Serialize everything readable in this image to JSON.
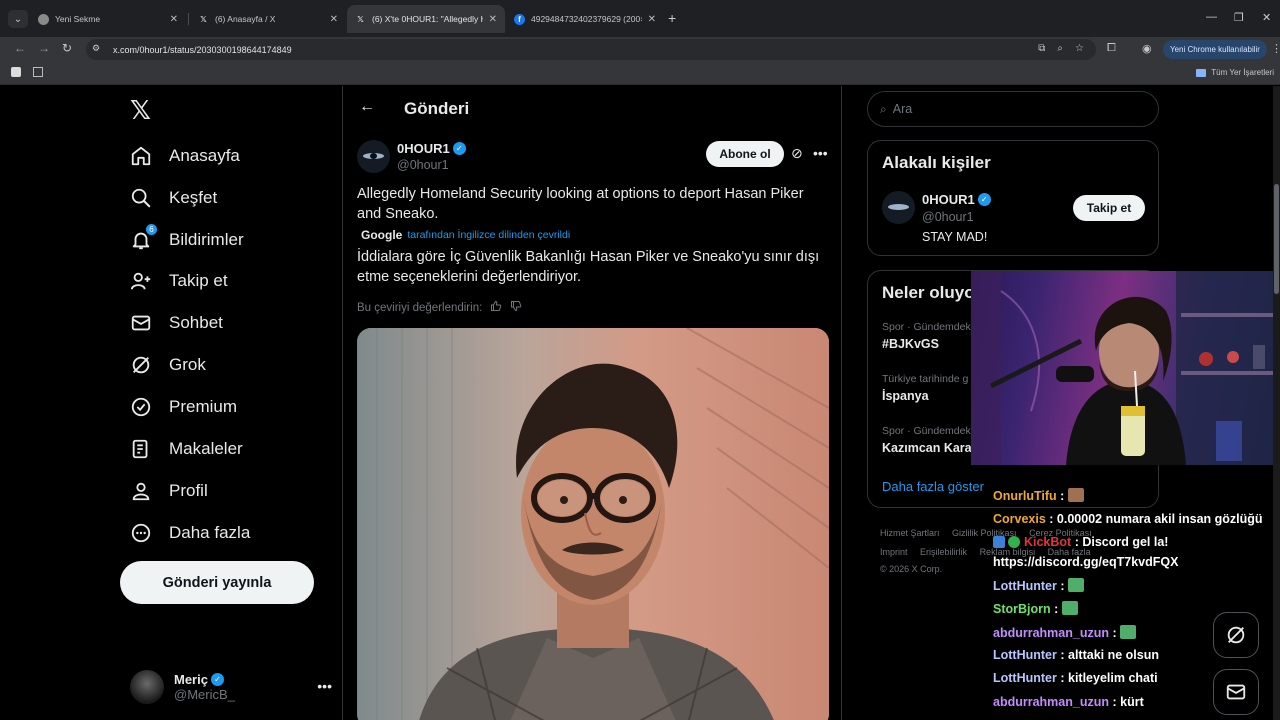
{
  "browser": {
    "tabs": [
      {
        "title": "Yeni Sekme",
        "favicon": "chrome-icon"
      },
      {
        "title": "(6) Anasayfa / X",
        "favicon": "x-icon"
      },
      {
        "title": "(6) X'te 0HOUR1: \"Allegedly Ho",
        "favicon": "x-icon"
      },
      {
        "title": "4929484732402379629 (200×2",
        "favicon": "facebook-icon"
      }
    ],
    "url": "x.com/0hour1/status/2030300198644174849",
    "promo_label": "Yeni Chrome kullanılabilir",
    "bookmarks_all": "Tüm Yer İşaretleri"
  },
  "nav": {
    "items": [
      {
        "label": "Anasayfa",
        "icon": "home-icon"
      },
      {
        "label": "Keşfet",
        "icon": "search-icon"
      },
      {
        "label": "Bildirimler",
        "icon": "bell-icon",
        "badge": "6"
      },
      {
        "label": "Takip et",
        "icon": "follow-icon"
      },
      {
        "label": "Sohbet",
        "icon": "mail-icon"
      },
      {
        "label": "Grok",
        "icon": "grok-icon"
      },
      {
        "label": "Premium",
        "icon": "premium-icon"
      },
      {
        "label": "Makaleler",
        "icon": "article-icon"
      },
      {
        "label": "Profil",
        "icon": "profile-icon"
      },
      {
        "label": "Daha fazla",
        "icon": "more-icon"
      }
    ],
    "post_button": "Gönderi yayınla",
    "account": {
      "name": "Meriç",
      "handle": "@MericB_"
    }
  },
  "post": {
    "header_title": "Gönderi",
    "author_name": "0HOUR1",
    "author_handle": "@0hour1",
    "subscribe_label": "Abone ol",
    "text": "Allegedly Homeland Security looking at options to deport Hasan Piker and Sneako.",
    "translation_by": "Google",
    "translation_note": "tarafından İngilizce dilinden çevrildi",
    "translated_text": "İddialara göre İç Güvenlik Bakanlığı Hasan Piker ve Sneako'yu sınır dışı etme seçeneklerini değerlendiriyor.",
    "rate_prompt": "Bu çeviriyi değerlendirin:"
  },
  "sidebar": {
    "search_placeholder": "Ara",
    "related_title": "Alakalı kişiler",
    "related": {
      "name": "0HOUR1",
      "handle": "@0hour1",
      "bio": "STAY MAD!",
      "follow_label": "Takip et"
    },
    "trends_title": "Neler oluyo",
    "trends": [
      {
        "category": "Spor · Gündemdek",
        "name": "#BJKvGS"
      },
      {
        "category": "Türkiye tarihinde g",
        "name": "İspanya"
      },
      {
        "category": "Spor · Gündemdek",
        "name": "Kazımcan Kara"
      }
    ],
    "show_more": "Daha fazla göster",
    "footer_row1": [
      "Hizmet Şartları",
      "Gizlilik Politikası",
      "Çerez Politikası"
    ],
    "footer_row2": [
      "Imprint",
      "Erişilebilirlik",
      "Reklam bilgisi",
      "Daha fazla"
    ],
    "copyright": "© 2026 X Corp."
  },
  "chat": [
    {
      "user": "OnurluTifu",
      "color": "#f0a830",
      "message": ":",
      "emote": true
    },
    {
      "user": "Corvexis",
      "color": "#f0a830",
      "message": ": 0.00002 numara akil insan gözlüğü",
      "emote": false
    },
    {
      "user": "KickBot",
      "color": "#e0353a",
      "message": ": Discord gel la!",
      "emote": false
    },
    {
      "user": "",
      "color": "#ffffff",
      "message": "https://discord.gg/eqT7kvdFQX",
      "emote": false
    },
    {
      "user": "LottHunter",
      "color": "#b8c6ff",
      "message": ":",
      "emote": true
    },
    {
      "user": "StorBjorn",
      "color": "#6ee36a",
      "message": ":",
      "emote": true
    },
    {
      "user": "abdurrahman_uzun",
      "color": "#c48bff",
      "message": ":",
      "emote": true
    },
    {
      "user": "LottHunter",
      "color": "#b8c6ff",
      "message": ": alttaki ne olsun",
      "emote": false
    },
    {
      "user": "LottHunter",
      "color": "#b8c6ff",
      "message": ": kitleyelim chati",
      "emote": false
    },
    {
      "user": "abdurrahman_uzun",
      "color": "#c48bff",
      "message": ": kürt",
      "emote": false
    }
  ],
  "colors": {
    "accent": "#1d9bf0",
    "background": "#000000",
    "border": "#2f3336"
  }
}
